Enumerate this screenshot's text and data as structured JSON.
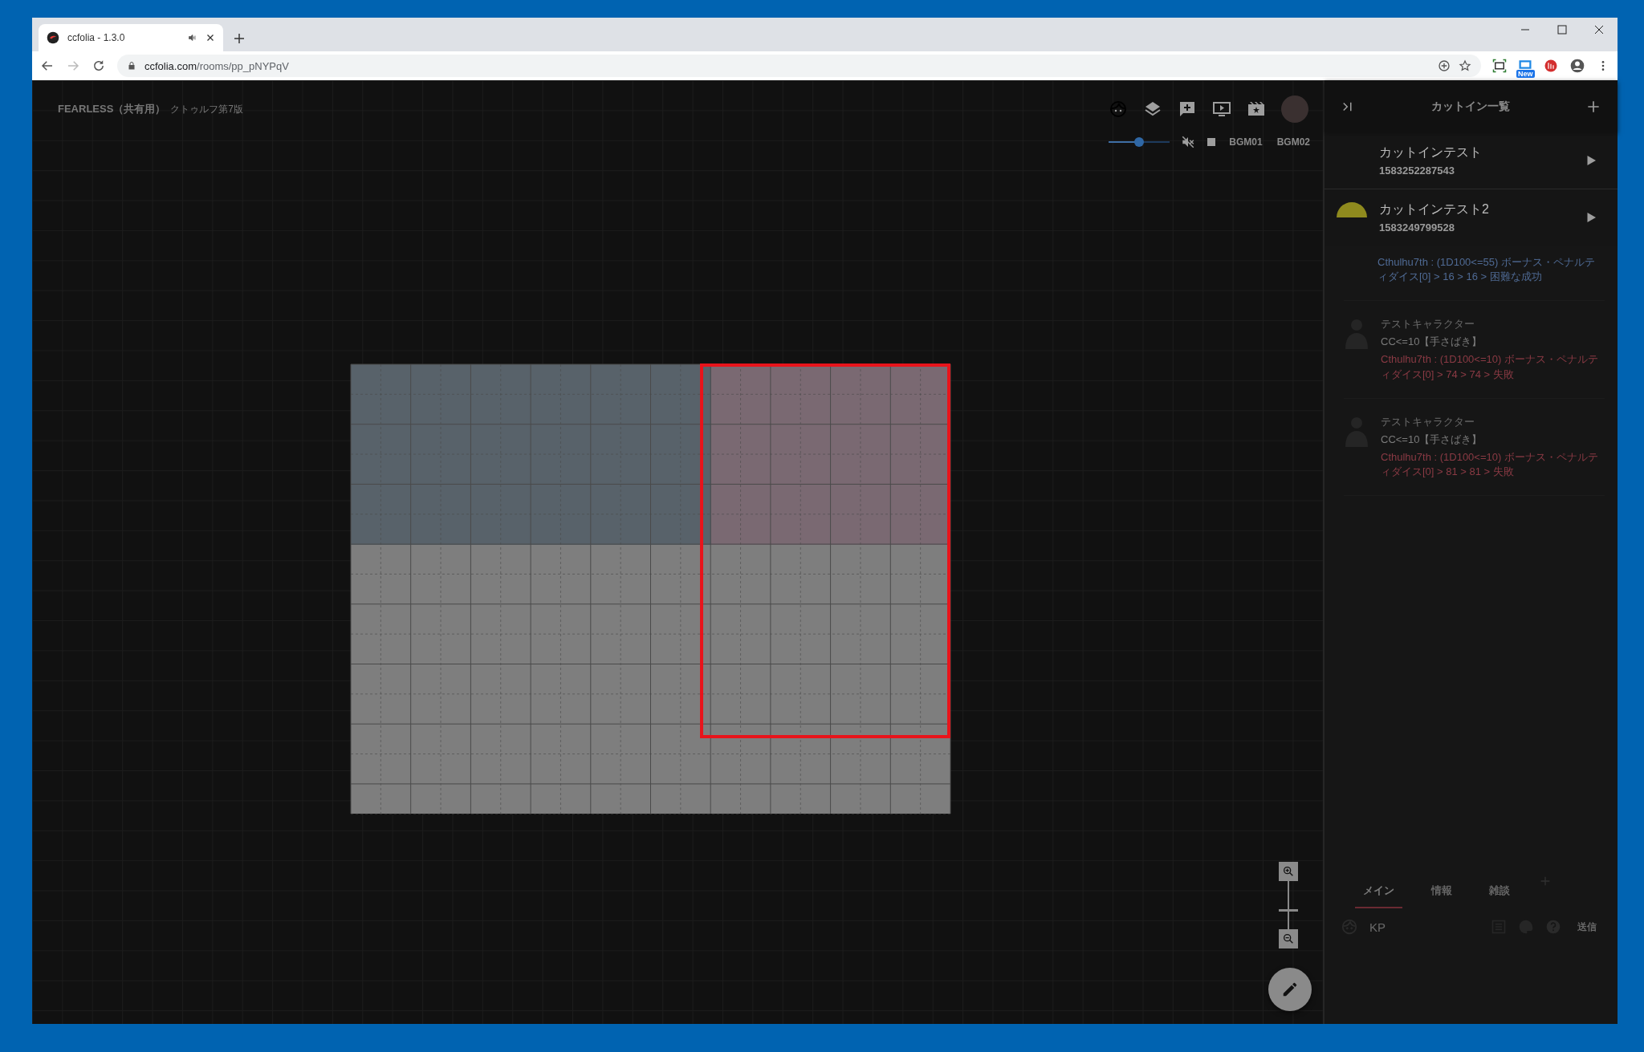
{
  "browser": {
    "tab_title": "ccfolia - 1.3.0",
    "url_host": "ccfolia.com",
    "url_path": "/rooms/pp_pNYPqV",
    "extension_badge": "New"
  },
  "room": {
    "title": "FEARLESS（共有用）",
    "system": "クトゥルフ第7版"
  },
  "bgm": {
    "level": 0.5,
    "muted": true,
    "tracks": [
      "BGM01",
      "BGM02"
    ]
  },
  "panel": {
    "title": "カットイン一覧"
  },
  "cutins": [
    {
      "name": "カットインテスト",
      "id": "1583252287543",
      "thumbnail": false
    },
    {
      "name": "カットインテスト2",
      "id": "1583249799528",
      "thumbnail": true
    }
  ],
  "chat_messages": [
    {
      "result": "Cthulhu7th : (1D100<=55) ボーナス・ペナルティダイス[0] > 16 > 16 > 困難な成功",
      "color": "#4f6a94"
    },
    {
      "name": "テストキャラクター",
      "command": "CC<=10【手さばき】",
      "result": "Cthulhu7th : (1D100<=10) ボーナス・ペナルティダイス[0] > 74 > 74 > 失敗",
      "color": "#8a3a44"
    },
    {
      "name": "テストキャラクター",
      "command": "CC<=10【手さばき】",
      "result": "Cthulhu7th : (1D100<=10) ボーナス・ペナルティダイス[0] > 81 > 81 > 失敗",
      "color": "#8a3a44"
    }
  ],
  "chat_tabs": [
    {
      "label": "メイン",
      "selected": true
    },
    {
      "label": "情報",
      "selected": false
    },
    {
      "label": "雑談",
      "selected": false
    }
  ],
  "composer": {
    "name": "KP",
    "send": "送信"
  },
  "zoom": {
    "level": 0.4
  }
}
